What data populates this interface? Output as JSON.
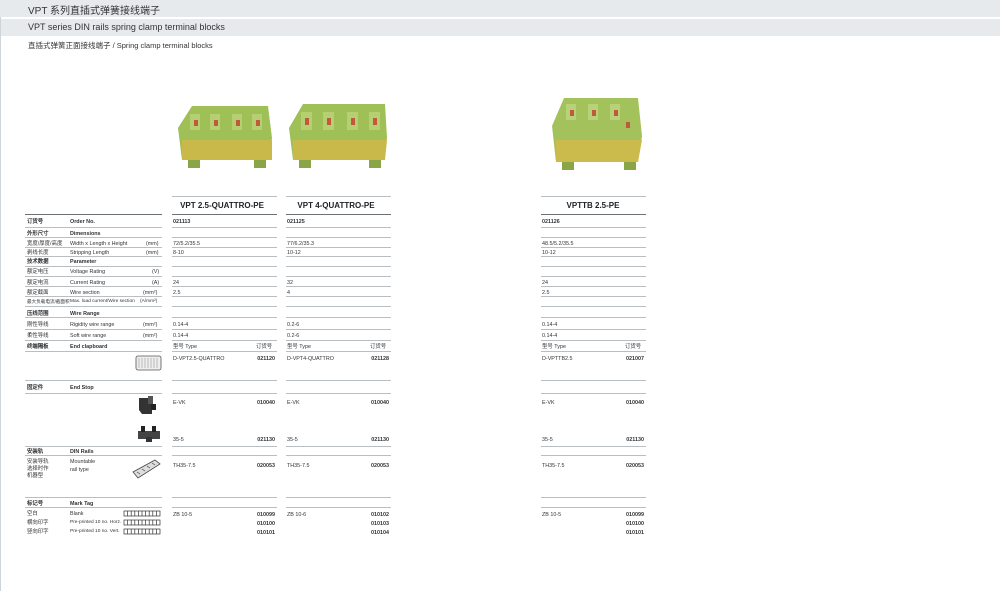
{
  "header": {
    "title_cn": "VPT 系列直插式弹簧接线端子",
    "title_en": "VPT series DIN rails spring clamp terminal blocks",
    "subtitle": "直插式弹簧正面接线端子 / Spring clamp terminal blocks"
  },
  "products": [
    {
      "name": "VPT 2.5-QUATTRO-PE",
      "order_no": "021113",
      "dimensions": "72/5.2/35.5",
      "stripping": "8-10",
      "current": "24",
      "wire_section": "2.5",
      "rigid": "0.14-4",
      "soft": "0.14-4",
      "end_cover_type": "D-VPT2.5-QUATTRO",
      "end_cover_no": "021120",
      "end_stop1_type": "E-VK",
      "end_stop1_no": "010040",
      "end_stop2_type": "35-5",
      "end_stop2_no": "021130",
      "rail_type": "TH35-7.5",
      "rail_no": "020053",
      "tag_type": "ZB 10-5",
      "tag_no1": "010099",
      "tag_no2": "010100",
      "tag_no3": "010101"
    },
    {
      "name": "VPT 4-QUATTRO-PE",
      "order_no": "021125",
      "dimensions": "77/6.2/35.3",
      "stripping": "10-12",
      "current": "32",
      "wire_section": "4",
      "rigid": "0.2-6",
      "soft": "0.2-6",
      "end_cover_type": "D-VPT4-QUATTRO",
      "end_cover_no": "021128",
      "end_stop1_type": "E-VK",
      "end_stop1_no": "010040",
      "end_stop2_type": "35-5",
      "end_stop2_no": "021130",
      "rail_type": "TH35-7.5",
      "rail_no": "020053",
      "tag_type": "ZB 10-6",
      "tag_no1": "010102",
      "tag_no2": "010103",
      "tag_no3": "010104"
    },
    {
      "name": "VPTTB 2.5-PE",
      "order_no": "021126",
      "dimensions": "48.5/5.2/35.5",
      "stripping": "10-12",
      "current": "24",
      "wire_section": "2.5",
      "rigid": "0.14-4",
      "soft": "0.14-4",
      "end_cover_type": "D-VPTTB2.5",
      "end_cover_no": "021007",
      "end_stop1_type": "E-VK",
      "end_stop1_no": "010040",
      "end_stop2_type": "35-5",
      "end_stop2_no": "021130",
      "rail_type": "TH35-7.5",
      "rail_no": "020053",
      "tag_type": "ZB 10-5",
      "tag_no1": "010099",
      "tag_no2": "010100",
      "tag_no3": "010101"
    }
  ],
  "labels": {
    "order_cn": "订货号",
    "order_en": "Order No.",
    "dim_cn": "外形尺寸",
    "dim_en": "Dimensions",
    "whl_cn": "宽度/厚度/高度",
    "whl_en": "Width x Length x Height",
    "whl_unit": "(mm)",
    "strip_cn": "剥线长度",
    "strip_en": "Stripping Length",
    "strip_unit": "(mm)",
    "param_cn": "技术数据",
    "param_en": "Parameter",
    "volt_cn": "额定电压",
    "volt_en": "Voltage Rating",
    "volt_unit": "(V)",
    "curr_cn": "额定电流",
    "curr_en": "Current Rating",
    "curr_unit": "(A)",
    "sect_cn": "额定截面",
    "sect_en": "Wire section",
    "sect_unit": "(mm²)",
    "max_cn": "最大负载电流/截面积",
    "max_en": "Max. load current/Wire section",
    "max_unit": "(A/mm²)",
    "range_cn": "压线范围",
    "range_en": "Wire Range",
    "rigid_cn": "刚性导线",
    "rigid_en": "Rigidity wire range",
    "rigid_unit": "(mm²)",
    "soft_cn": "柔性导线",
    "soft_en": "Soft wire range",
    "soft_unit": "(mm²)",
    "cover_cn": "终端隔板",
    "cover_en": "End clapboard",
    "col_type": "型号 Type",
    "col_order": "订货号",
    "stop_cn": "固定件",
    "stop_en": "End Stop",
    "rail_cn": "安装轨",
    "rail_en": "DIN Rails",
    "rail_cn2": "安装导轨",
    "rail_cn3": "选择时作",
    "rail_cn4": "机器型",
    "rail_en2": "Mountable",
    "rail_en3": "rail type",
    "tag_cn": "标记号",
    "tag_en": "Mark Tag",
    "blank_cn": "空白",
    "blank_en": "Blank",
    "horz_cn": "横向印字",
    "horz_en": "Pre-printed 10 no. Horz.",
    "vert_cn": "竖向印字",
    "vert_en": "Pre-printed 10 no. Vert."
  }
}
